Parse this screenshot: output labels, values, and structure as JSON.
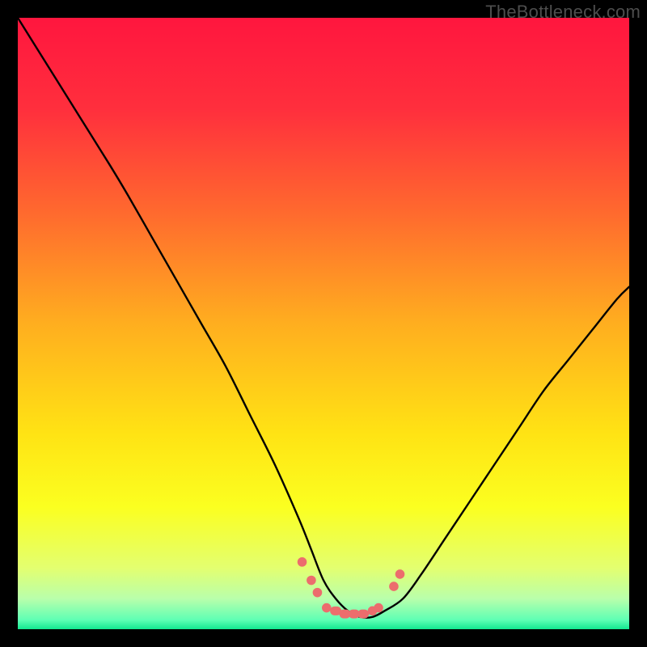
{
  "watermark": "TheBottleneck.com",
  "colors": {
    "frame": "#000000",
    "gradient_stops": [
      {
        "offset": 0.0,
        "color": "#ff163e"
      },
      {
        "offset": 0.15,
        "color": "#ff2f3d"
      },
      {
        "offset": 0.32,
        "color": "#ff6a2e"
      },
      {
        "offset": 0.5,
        "color": "#ffae1f"
      },
      {
        "offset": 0.68,
        "color": "#ffe314"
      },
      {
        "offset": 0.8,
        "color": "#fbff20"
      },
      {
        "offset": 0.9,
        "color": "#e3ff70"
      },
      {
        "offset": 0.95,
        "color": "#b9ffab"
      },
      {
        "offset": 0.985,
        "color": "#5effb4"
      },
      {
        "offset": 1.0,
        "color": "#12e890"
      }
    ],
    "curve": "#000000",
    "marker": "#ec6d6d"
  },
  "chart_data": {
    "type": "line",
    "title": "",
    "xlabel": "",
    "ylabel": "",
    "xlim": [
      0,
      100
    ],
    "ylim": [
      0,
      100
    ],
    "grid": false,
    "legend": false,
    "series": [
      {
        "name": "bottleneck-curve",
        "x": [
          0,
          5,
          10,
          15,
          18,
          22,
          26,
          30,
          34,
          38,
          42,
          46,
          48,
          50,
          52,
          54,
          56,
          58,
          60,
          63,
          66,
          70,
          74,
          78,
          82,
          86,
          90,
          94,
          98,
          100
        ],
        "y": [
          100,
          92,
          84,
          76,
          71,
          64,
          57,
          50,
          43,
          35,
          27,
          18,
          13,
          8,
          5,
          3,
          2,
          2,
          3,
          5,
          9,
          15,
          21,
          27,
          33,
          39,
          44,
          49,
          54,
          56
        ]
      }
    ],
    "markers": {
      "name": "bottom-dots",
      "x": [
        46.5,
        48,
        49,
        50.5,
        52,
        53.5,
        55,
        56.5,
        58,
        59,
        61.5,
        62.5
      ],
      "y": [
        11,
        8,
        6,
        3.5,
        3,
        2.5,
        2.5,
        2.5,
        3,
        3.5,
        7,
        9
      ]
    }
  }
}
